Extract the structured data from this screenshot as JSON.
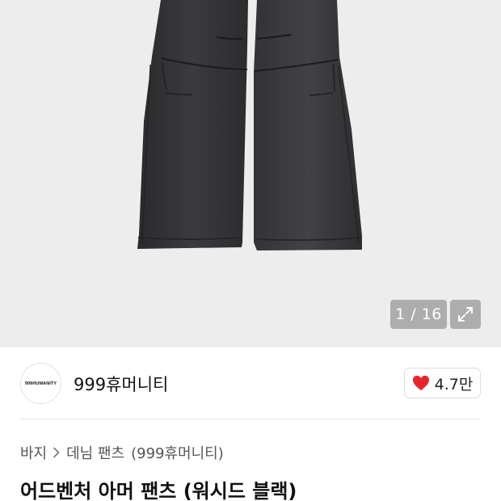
{
  "gallery": {
    "counter": "1 / 16",
    "expand_icon": "expand-arrows-icon",
    "image": "product-photo-black-denim-pants"
  },
  "brand": {
    "logo_text": "999HUMANITY",
    "name": "999휴머니티"
  },
  "like": {
    "icon": "heart-icon",
    "color": "#e8262a",
    "count": "4.7만"
  },
  "breadcrumb": {
    "category": "바지",
    "subcategory": "데님 팬츠",
    "brand": "(999휴머니티)"
  },
  "product": {
    "title": "어드벤처 아머 팬츠 (워시드 블랙)"
  }
}
